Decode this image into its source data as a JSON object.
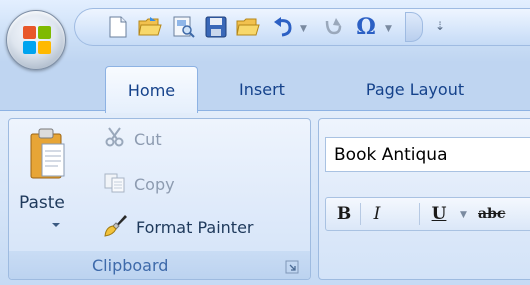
{
  "quick_access": {
    "icons": [
      "new-document-icon",
      "open-folder-icon",
      "print-preview-icon",
      "save-icon",
      "open-icon",
      "undo-icon",
      "redo-icon",
      "symbol-omega-icon"
    ],
    "symbol_glyph": "Ω"
  },
  "tabs": [
    {
      "label": "Home",
      "active": true
    },
    {
      "label": "Insert",
      "active": false
    },
    {
      "label": "Page Layout",
      "active": false
    }
  ],
  "clipboard": {
    "group_label": "Clipboard",
    "paste_label": "Paste",
    "cut_label": "Cut",
    "copy_label": "Copy",
    "format_painter_label": "Format Painter"
  },
  "font": {
    "font_name": "Book Antiqua",
    "bold_glyph": "B",
    "italic_glyph": "I",
    "underline_glyph": "U",
    "strikethrough_glyph": "abc"
  },
  "colors": {
    "ribbon_text": "#15428b",
    "ribbon_bg": "#dfeafa",
    "accent_border": "#8db2e3"
  }
}
